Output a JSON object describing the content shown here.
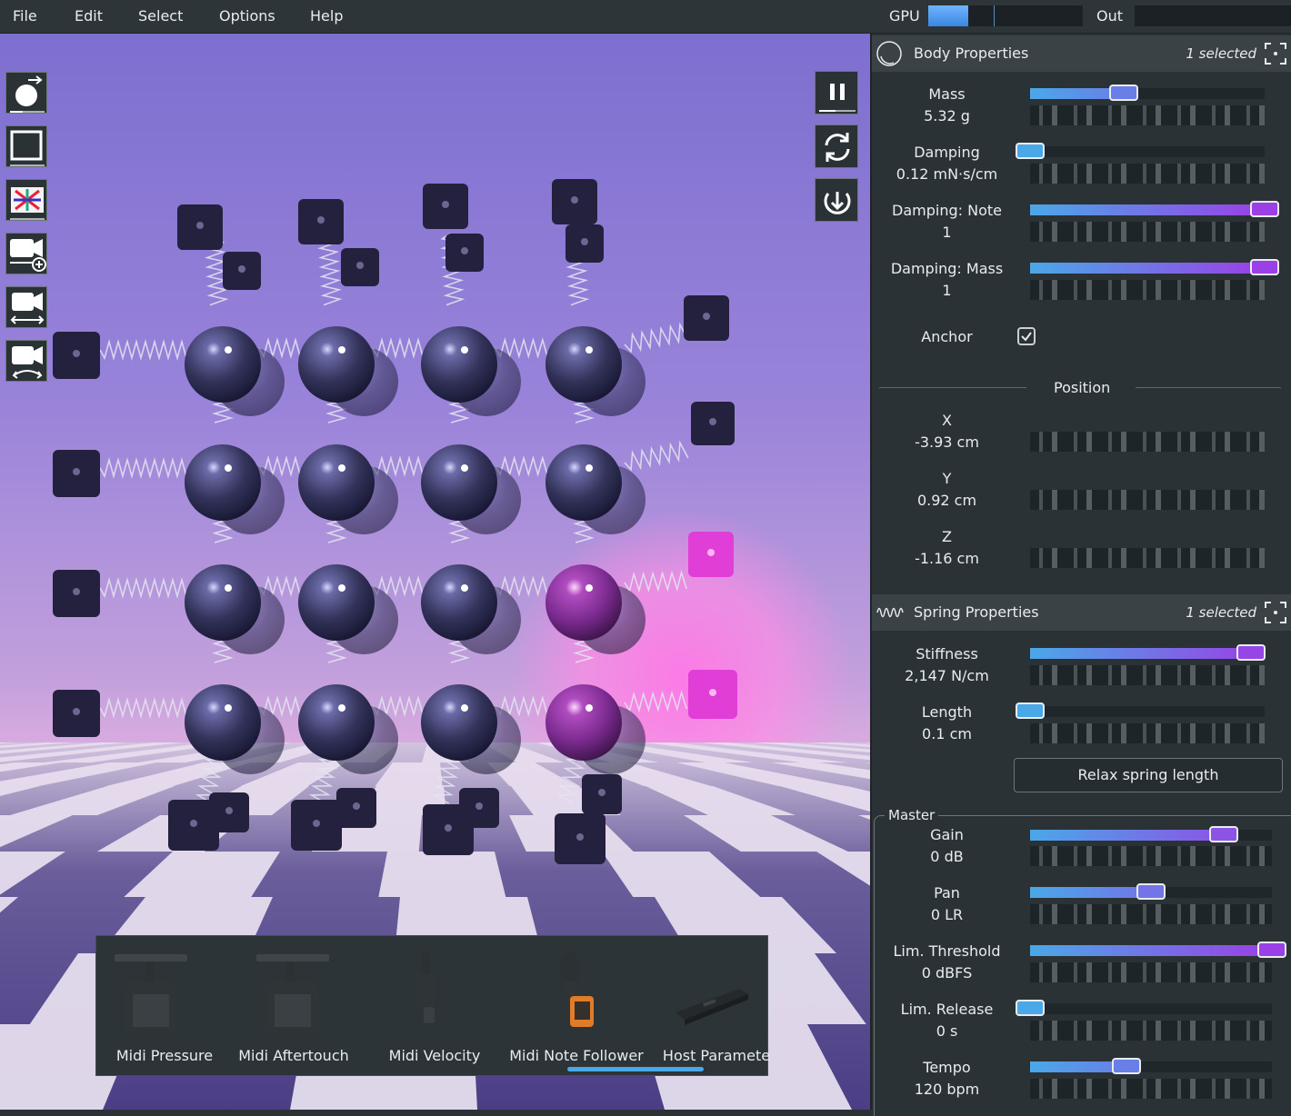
{
  "menu": {
    "items": [
      "File",
      "Edit",
      "Select",
      "Options",
      "Help"
    ],
    "gpu_label": "GPU",
    "gpu_level": 0.26,
    "out_label": "Out",
    "out_level": 0
  },
  "toolbar": {
    "icons": [
      "add-body-icon",
      "select-box-icon",
      "visual-effects-icon",
      "add-camera-icon",
      "camera-pan-icon",
      "camera-orbit-icon"
    ]
  },
  "controls": {
    "icons": [
      "pause-icon",
      "reset-icon",
      "restore-icon"
    ]
  },
  "palette": {
    "items": [
      {
        "label": "Midi Pressure",
        "icon": "midi-pressure-icon"
      },
      {
        "label": "Midi Aftertouch",
        "icon": "midi-aftertouch-icon"
      },
      {
        "label": "Midi Velocity",
        "icon": "midi-velocity-icon"
      },
      {
        "label": "Midi Note Follower",
        "icon": "midi-note-follower-icon"
      },
      {
        "label": "Host Paramete",
        "icon": "host-parameter-icon"
      }
    ]
  },
  "body_properties": {
    "title": "Body Properties",
    "selected": "1 selected",
    "mass": {
      "label": "Mass",
      "value": "5.32 g",
      "level": 0.4
    },
    "damping": {
      "label": "Damping",
      "value": "0.12 mN·s/cm",
      "level": 0.0
    },
    "damping_note": {
      "label": "Damping: Note",
      "value": "1",
      "level": 1.0
    },
    "damping_mass": {
      "label": "Damping: Mass",
      "value": "1",
      "level": 1.0
    },
    "anchor": {
      "label": "Anchor",
      "checked": true
    },
    "position": {
      "title": "Position",
      "x": {
        "label": "X",
        "value": "-3.93 cm"
      },
      "y": {
        "label": "Y",
        "value": "0.92 cm"
      },
      "z": {
        "label": "Z",
        "value": "-1.16 cm"
      }
    }
  },
  "spring_properties": {
    "title": "Spring Properties",
    "selected": "1 selected",
    "stiffness": {
      "label": "Stiffness",
      "value": "2,147 N/cm",
      "level": 0.94
    },
    "length": {
      "label": "Length",
      "value": "0.1 cm",
      "level": 0.0
    },
    "relax_button": "Relax spring length"
  },
  "master": {
    "title": "Master",
    "gain": {
      "label": "Gain",
      "value": "0 dB",
      "level": 0.8
    },
    "pan": {
      "label": "Pan",
      "value": "0 LR",
      "level": 0.5
    },
    "lim_threshold": {
      "label": "Lim. Threshold",
      "value": "0 dBFS",
      "level": 1.0
    },
    "lim_release": {
      "label": "Lim. Release",
      "value": "0 s",
      "level": 0.0
    },
    "tempo": {
      "label": "Tempo",
      "value": "120 bpm",
      "level": 0.4
    }
  },
  "colors": {
    "slider_start": "#4aa8e8",
    "slider_end": "#9b3fe6",
    "panel_bg": "#2b3236",
    "accent_glow": "#ff5fe0"
  }
}
